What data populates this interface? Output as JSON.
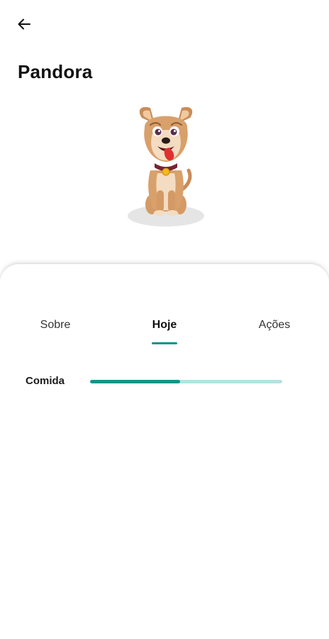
{
  "header": {
    "back_icon": "arrow-left-icon",
    "title": "Pandora"
  },
  "pet": {
    "illustration": "dog-illustration"
  },
  "tabs": [
    {
      "label": "Sobre",
      "active": false
    },
    {
      "label": "Hoje",
      "active": true
    },
    {
      "label": "Ações",
      "active": false
    }
  ],
  "stats": [
    {
      "label": "Comida",
      "progress": 0.47
    }
  ],
  "colors": {
    "accent": "#13948a",
    "track": "#b5e3df"
  }
}
